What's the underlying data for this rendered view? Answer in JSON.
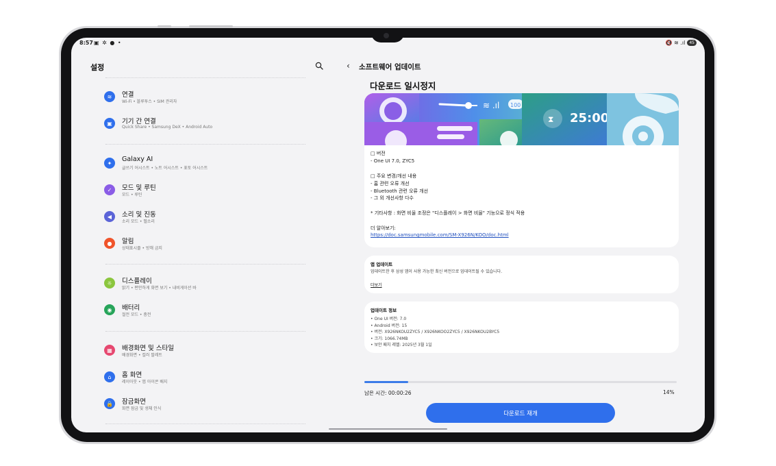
{
  "status": {
    "time": "8:57",
    "left_icons": "▣ ✲ ● •",
    "right_icons": "🔇 ≋ .ıl",
    "battery": "45"
  },
  "left": {
    "title": "설정",
    "items": [
      {
        "title": "연결",
        "sub": "Wi-Fi • 블루투스 • SIM 관리자",
        "color": "#2f6fec",
        "icon": "wifi-icon",
        "glyph": "≋"
      },
      {
        "title": "기기 간 연결",
        "sub": "Quick Share • Samsung DeX • Android Auto",
        "color": "#2f6fec",
        "icon": "devices-icon",
        "glyph": "▣"
      },
      {
        "title": "Galaxy AI",
        "sub": "글쓰기 어시스트 • 노트 어시스트 • 표토 어시스트",
        "color": "#2f6fec",
        "icon": "sparkle-icon",
        "glyph": "✦"
      },
      {
        "title": "모드 및 루틴",
        "sub": "모드 • 루틴",
        "color": "#8a5ce6",
        "icon": "modes-icon",
        "glyph": "✓"
      },
      {
        "title": "소리 및 진동",
        "sub": "소리 모드 • 벨소리",
        "color": "#5b64d8",
        "icon": "sound-icon",
        "glyph": "◀"
      },
      {
        "title": "알림",
        "sub": "상태표시줄 • 방해 금지",
        "color": "#f0542b",
        "icon": "bell-icon",
        "glyph": "●"
      },
      {
        "title": "디스플레이",
        "sub": "밝기 • 편안하게 화면 보기 • 내비게이션 바",
        "color": "#8bc63e",
        "icon": "brightness-icon",
        "glyph": "☼"
      },
      {
        "title": "배터리",
        "sub": "절전 모드 • 충전",
        "color": "#27a45a",
        "icon": "battery-icon",
        "glyph": "◉"
      },
      {
        "title": "배경화면 및 스타일",
        "sub": "배경화면 • 컬러 팔레트",
        "color": "#e64870",
        "icon": "wallpaper-icon",
        "glyph": "▦"
      },
      {
        "title": "홈 화면",
        "sub": "레이아웃 • 앱 아이콘 배지",
        "color": "#2f6fec",
        "icon": "home-icon",
        "glyph": "⌂"
      },
      {
        "title": "잠금화면",
        "sub": "화면 잠금 및 생체 인식",
        "color": "#2f6fec",
        "icon": "lock-icon",
        "glyph": "🔒"
      }
    ]
  },
  "right": {
    "header": "소프트웨어 업데이트",
    "title": "다운로드 일시정지",
    "banner_timer": "25:00",
    "banner_badge": "100",
    "notes": [
      "□ 버전",
      "- One UI 7.0, ZYC5",
      "",
      "□ 주요 변경/개선 내용",
      "- 홈 관련 오류 개선",
      "- Bluetooth 관련 오류 개선",
      "- 그 외 개선사항 다수",
      "",
      "* 기타사항 : 화면 비율 조정은 \"디스플레이 > 화면 비율\" 기능으로 정식 적용",
      "",
      "더 알아보기:"
    ],
    "link": "https://doc.samsungmobile.com/SM-X926N/KOO/doc.html",
    "app_update": {
      "heading": "앱 업데이트",
      "body": "업데이트한 후 삼성 앱이 사용 가능한 최신 버전으로 업데이트될 수 있습니다.",
      "more": "더보기"
    },
    "update_info": {
      "heading": "업데이트 정보",
      "lines": [
        "• One UI 버전: 7.0",
        "• Android 버전: 15",
        "• 버전: X926NKOU2ZYC5 / X926NKOO2ZYC5 / X926NKOU2BYC5",
        "• 크기: 1066.74MB",
        "• 보안 패치 레벨: 2025년 3월 1일"
      ]
    },
    "remaining": "남은 시간: 00:00:26",
    "percent": "14%",
    "progress": 0.14,
    "resume_button": "다운로드 재개"
  }
}
